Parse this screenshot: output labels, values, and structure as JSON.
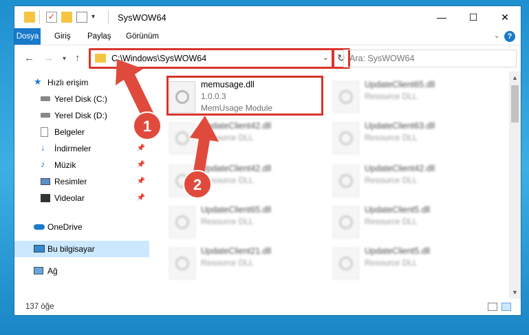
{
  "window": {
    "title": "SysWOW64",
    "controls": {
      "minimize": "—",
      "maximize": "☐",
      "close": "✕"
    }
  },
  "ribbon": {
    "tabs": [
      "Dosya",
      "Giriş",
      "Paylaş",
      "Görünüm"
    ],
    "help": "?"
  },
  "nav": {
    "address": "C:\\Windows\\SysWOW64",
    "search_placeholder": "Ara: SysWOW64"
  },
  "sidebar": {
    "items": [
      {
        "label": "Hızlı erişim",
        "icon": "star-icon"
      },
      {
        "label": "Yerel Disk (C:)",
        "icon": "drive-icon",
        "pinned": true
      },
      {
        "label": "Yerel Disk (D:)",
        "icon": "drive-icon"
      },
      {
        "label": "Belgeler",
        "icon": "documents-icon"
      },
      {
        "label": "İndirmeler",
        "icon": "download-icon",
        "pinned": true
      },
      {
        "label": "Müzik",
        "icon": "music-icon",
        "pinned": true
      },
      {
        "label": "Resimler",
        "icon": "pictures-icon",
        "pinned": true
      },
      {
        "label": "Videolar",
        "icon": "videos-icon",
        "pinned": true
      },
      {
        "label": "OneDrive",
        "icon": "cloud-icon"
      },
      {
        "label": "Bu bilgisayar",
        "icon": "computer-icon",
        "selected": true
      },
      {
        "label": "Ağ",
        "icon": "network-icon"
      }
    ]
  },
  "files": {
    "left": [
      {
        "name": "memusage.dll",
        "version": "1.0.0.3",
        "desc": "MemUsage Module",
        "selected": true
      },
      {
        "name": "UpdateClient42.dll",
        "desc": "Resource DLL"
      },
      {
        "name": "UpdateClient42.dll",
        "desc": "Resource DLL"
      },
      {
        "name": "UpdateClient65.dll",
        "desc": "Resource DLL"
      },
      {
        "name": "UpdateClient21.dll",
        "desc": "Resource DLL"
      }
    ],
    "right": [
      {
        "name": "UpdateClient65.dll",
        "desc": "Resource DLL"
      },
      {
        "name": "UpdateClient63.dll",
        "desc": "Resource DLL"
      },
      {
        "name": "UpdateClient42.dll",
        "desc": "Resource DLL"
      },
      {
        "name": "UpdateClient5.dll",
        "desc": "Resource DLL"
      },
      {
        "name": "UpdateClient5.dll",
        "desc": "Resource DLL"
      }
    ]
  },
  "status": {
    "count": "137 öğe"
  },
  "annotations": {
    "badge1": "1",
    "badge2": "2",
    "color": "#e04a3c"
  }
}
